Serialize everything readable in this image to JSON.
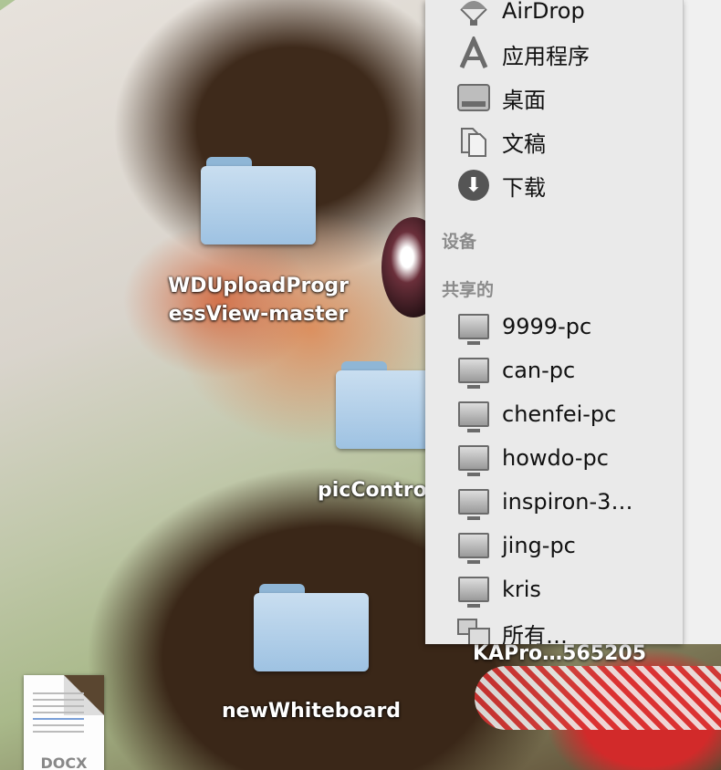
{
  "desktop": {
    "icons": [
      {
        "label_line1": "WDUploadProgr",
        "label_line2": "essView-master",
        "type": "folder"
      },
      {
        "label": "picContro",
        "type": "folder"
      },
      {
        "label": "newWhiteboard",
        "type": "folder"
      },
      {
        "label": "DOCX",
        "type": "document"
      }
    ],
    "partial_label": "KAPro…565205"
  },
  "sidebar": {
    "favorites": [
      {
        "label": "AirDrop",
        "icon": "airdrop-icon"
      },
      {
        "label": "应用程序",
        "icon": "applications-icon"
      },
      {
        "label": "桌面",
        "icon": "desktop-icon"
      },
      {
        "label": "文稿",
        "icon": "documents-icon"
      },
      {
        "label": "下载",
        "icon": "downloads-icon"
      }
    ],
    "devices_header": "设备",
    "shared_header": "共享的",
    "shared": [
      {
        "label": "9999-pc",
        "icon": "computer-icon"
      },
      {
        "label": "can-pc",
        "icon": "computer-icon"
      },
      {
        "label": "chenfei-pc",
        "icon": "computer-icon"
      },
      {
        "label": "howdo-pc",
        "icon": "computer-icon"
      },
      {
        "label": "inspiron-3…",
        "icon": "computer-icon"
      },
      {
        "label": "jing-pc",
        "icon": "computer-icon"
      },
      {
        "label": "kris",
        "icon": "computer-icon"
      },
      {
        "label": "所有…",
        "icon": "network-icon"
      }
    ]
  }
}
